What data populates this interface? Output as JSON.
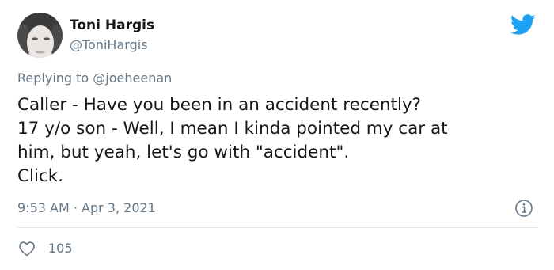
{
  "author": {
    "display_name": "Toni Hargis",
    "handle": "@ToniHargis"
  },
  "reply": {
    "prefix": "Replying to ",
    "mention": "@joeheenan"
  },
  "tweet": {
    "lines": [
      "Caller - Have you been in an accident recently?",
      "17 y/o son - Well, I mean I kinda pointed my car at",
      "him, but yeah, let's go with \"accident\".",
      "Click."
    ],
    "timestamp": "9:53 AM · Apr 3, 2021"
  },
  "stats": {
    "likes": "105"
  },
  "icons": {
    "brand": "twitter-bird-icon",
    "info": "info-icon",
    "like": "heart-icon"
  },
  "colors": {
    "brand_blue": "#1da1f2",
    "text_primary": "#14171a",
    "text_secondary": "#657786",
    "divider": "#e1e8ed"
  }
}
